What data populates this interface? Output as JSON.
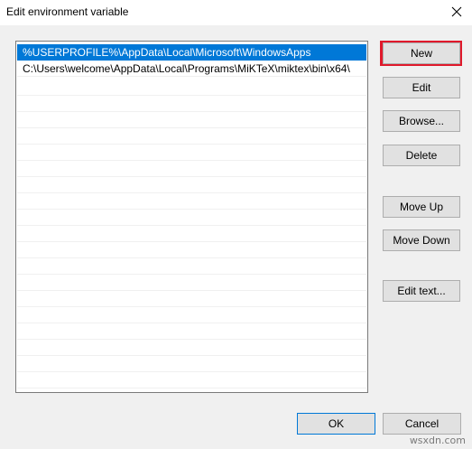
{
  "window": {
    "title": "Edit environment variable",
    "close_icon": "close-icon"
  },
  "list": {
    "items": [
      {
        "label": "%USERPROFILE%\\AppData\\Local\\Microsoft\\WindowsApps",
        "selected": true
      },
      {
        "label": "C:\\Users\\welcome\\AppData\\Local\\Programs\\MiKTeX\\miktex\\bin\\x64\\",
        "selected": false
      }
    ],
    "empty_rows": 19
  },
  "buttons": {
    "new": "New",
    "edit": "Edit",
    "browse": "Browse...",
    "delete": "Delete",
    "move_up": "Move Up",
    "move_down": "Move Down",
    "edit_text": "Edit text...",
    "ok": "OK",
    "cancel": "Cancel"
  },
  "colors": {
    "selection": "#0078d7",
    "highlight_box": "#e0192b"
  },
  "watermark": "wsxdn.com"
}
